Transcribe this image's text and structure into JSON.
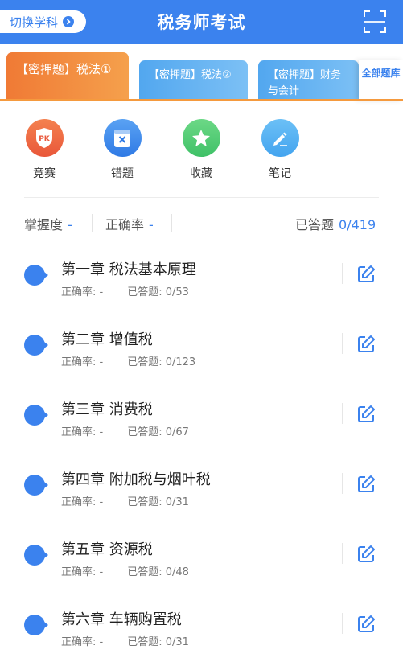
{
  "header": {
    "switch_label": "切换学科",
    "title": "税务师考试",
    "scan_icon": "scan-icon",
    "background": "#3b82ee"
  },
  "tabs": [
    {
      "label": "【密押题】税法①",
      "active": true
    },
    {
      "label": "【密押题】税法②",
      "active": false
    },
    {
      "label": "【密押题】财务与会计",
      "active": false
    }
  ],
  "all_bank_label": "全部题库",
  "quick_actions": [
    {
      "label": "竞赛",
      "icon": "pk-icon"
    },
    {
      "label": "错题",
      "icon": "wrong-book-icon"
    },
    {
      "label": "收藏",
      "icon": "star-icon"
    },
    {
      "label": "笔记",
      "icon": "pencil-icon"
    }
  ],
  "stats": {
    "mastery_label": "掌握度",
    "mastery_value": "-",
    "accuracy_label": "正确率",
    "accuracy_value": "-",
    "answered_label": "已答题",
    "answered_value": "0/419"
  },
  "chapter_meta": {
    "accuracy_label": "正确率: -",
    "answered_prefix": "已答题: "
  },
  "chapters": [
    {
      "title": "第一章 税法基本原理",
      "accuracy": "正确率: -",
      "answered": "已答题: 0/53"
    },
    {
      "title": "第二章 增值税",
      "accuracy": "正确率: -",
      "answered": "已答题: 0/123"
    },
    {
      "title": "第三章 消费税",
      "accuracy": "正确率: -",
      "answered": "已答题: 0/67"
    },
    {
      "title": "第四章 附加税与烟叶税",
      "accuracy": "正确率: -",
      "answered": "已答题: 0/31"
    },
    {
      "title": "第五章 资源税",
      "accuracy": "正确率: -",
      "answered": "已答题: 0/48"
    },
    {
      "title": "第六章 车辆购置税",
      "accuracy": "正确率: -",
      "answered": "已答题: 0/31"
    }
  ]
}
